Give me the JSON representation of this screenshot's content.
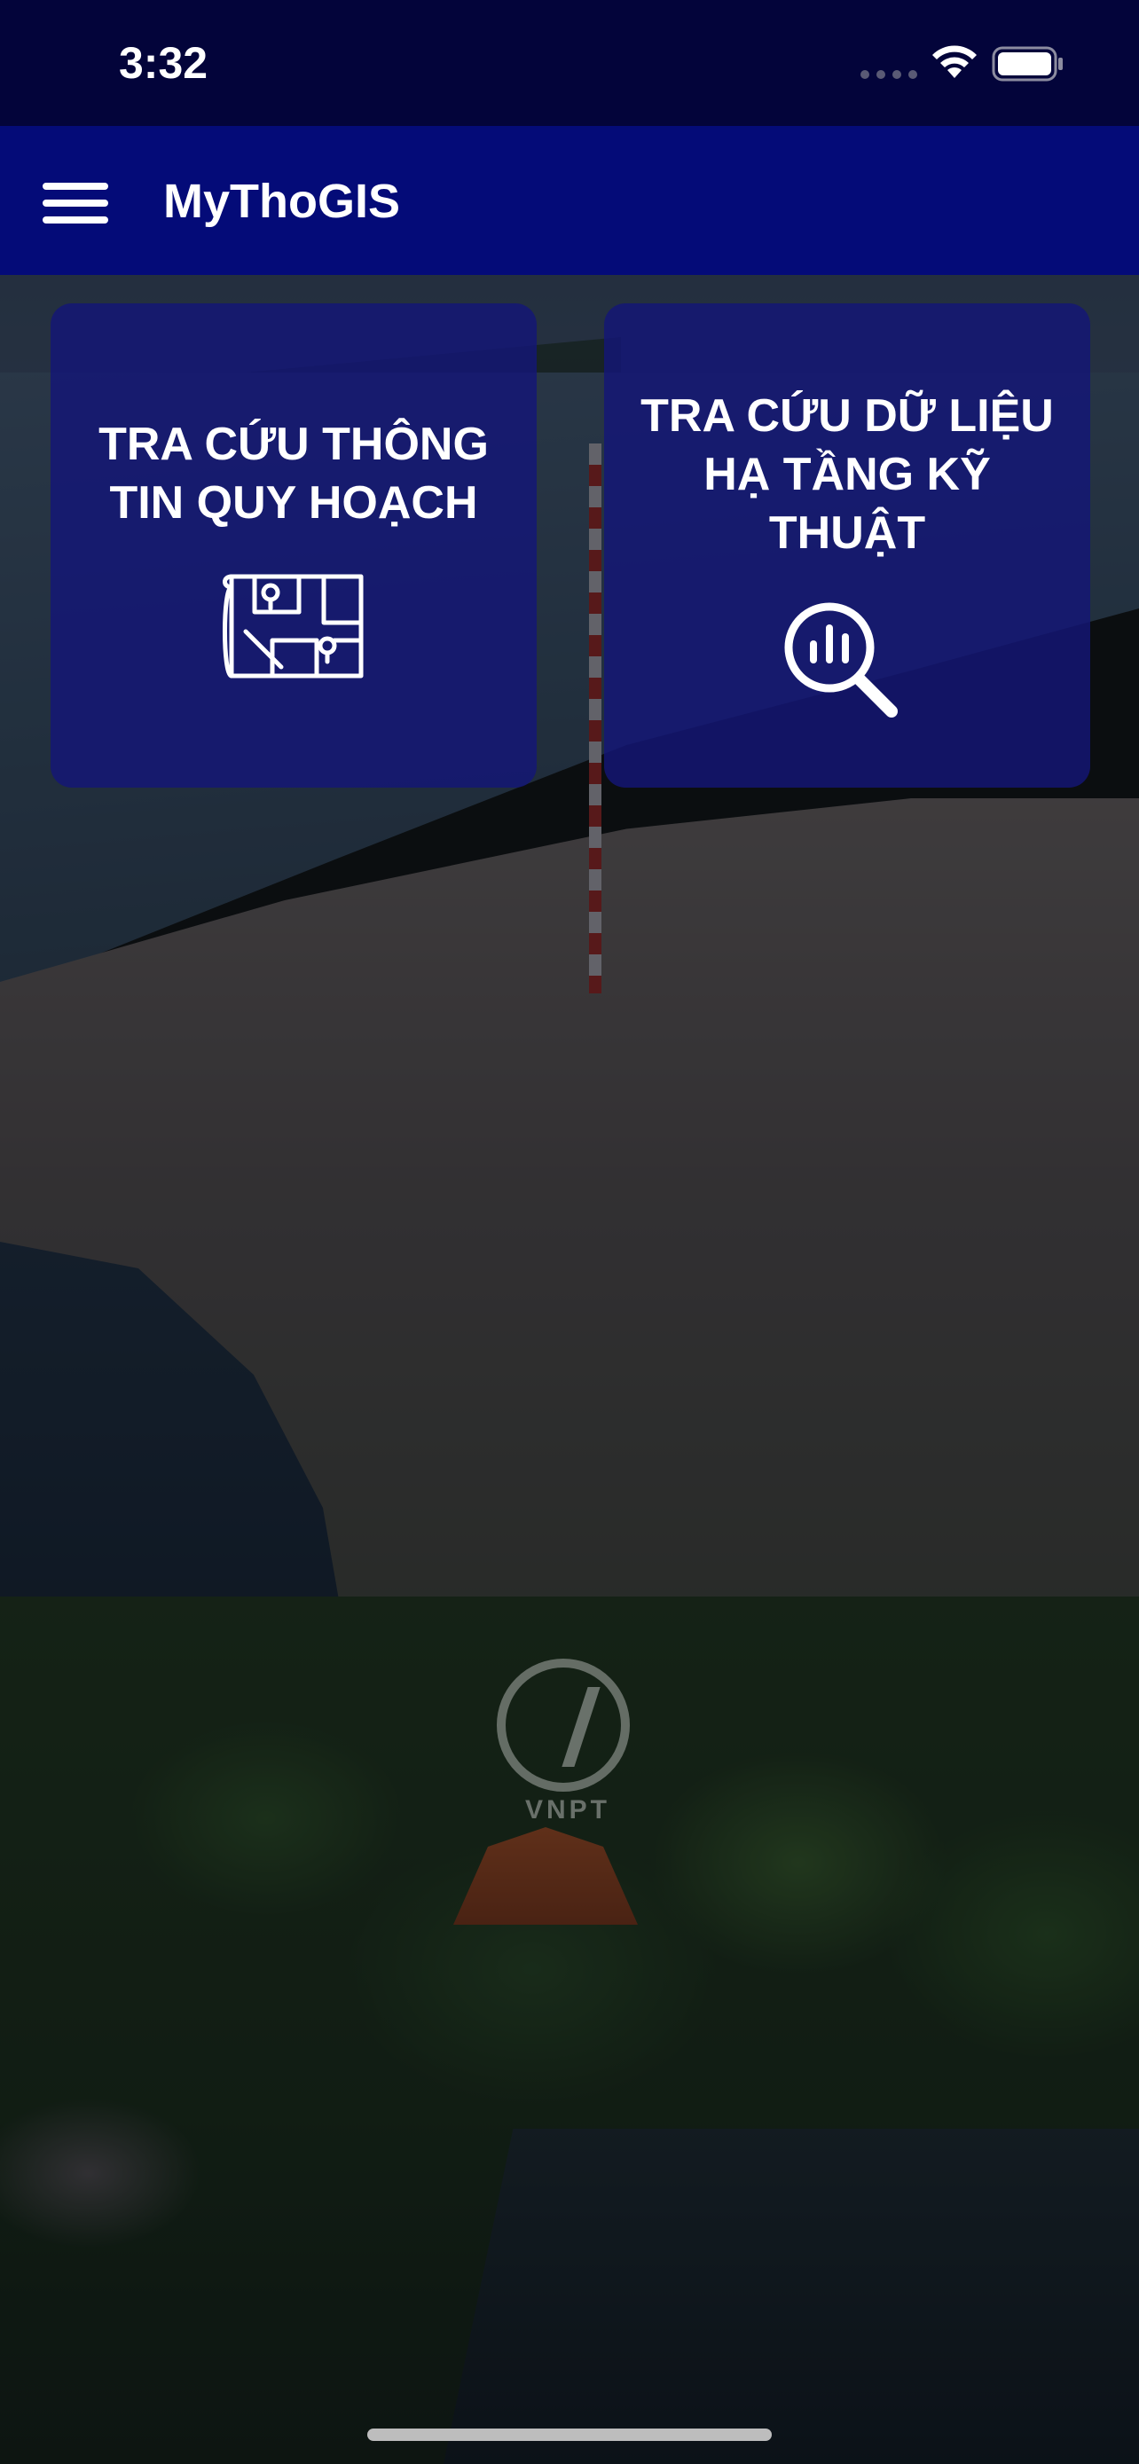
{
  "status_bar": {
    "time": "3:32"
  },
  "app_bar": {
    "title": "MyThoGIS",
    "menu_icon": "hamburger-menu-icon"
  },
  "cards": [
    {
      "title": "TRA CỨU THÔNG TIN QUY HOẠCH",
      "icon": "map-pin-icon"
    },
    {
      "title": "TRA CỨU DỮ LIỆU HẠ TẦNG KỸ THUẬT",
      "icon": "search-chart-icon"
    }
  ],
  "watermark": {
    "text": "VNPT"
  },
  "colors": {
    "status_bar_bg": "#03043a",
    "app_bar_bg": "#040b78",
    "card_bg": "#14167a",
    "text": "#ffffff"
  }
}
